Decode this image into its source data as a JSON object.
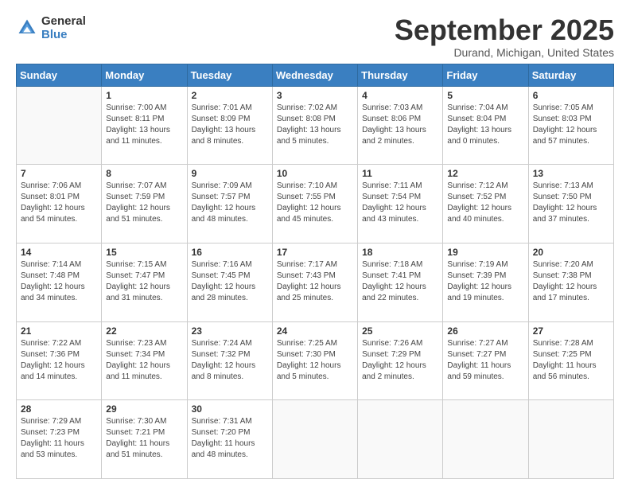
{
  "header": {
    "logo_line1": "General",
    "logo_line2": "Blue",
    "month": "September 2025",
    "location": "Durand, Michigan, United States"
  },
  "weekdays": [
    "Sunday",
    "Monday",
    "Tuesday",
    "Wednesday",
    "Thursday",
    "Friday",
    "Saturday"
  ],
  "weeks": [
    [
      {
        "day": "",
        "info": ""
      },
      {
        "day": "1",
        "info": "Sunrise: 7:00 AM\nSunset: 8:11 PM\nDaylight: 13 hours\nand 11 minutes."
      },
      {
        "day": "2",
        "info": "Sunrise: 7:01 AM\nSunset: 8:09 PM\nDaylight: 13 hours\nand 8 minutes."
      },
      {
        "day": "3",
        "info": "Sunrise: 7:02 AM\nSunset: 8:08 PM\nDaylight: 13 hours\nand 5 minutes."
      },
      {
        "day": "4",
        "info": "Sunrise: 7:03 AM\nSunset: 8:06 PM\nDaylight: 13 hours\nand 2 minutes."
      },
      {
        "day": "5",
        "info": "Sunrise: 7:04 AM\nSunset: 8:04 PM\nDaylight: 13 hours\nand 0 minutes."
      },
      {
        "day": "6",
        "info": "Sunrise: 7:05 AM\nSunset: 8:03 PM\nDaylight: 12 hours\nand 57 minutes."
      }
    ],
    [
      {
        "day": "7",
        "info": "Sunrise: 7:06 AM\nSunset: 8:01 PM\nDaylight: 12 hours\nand 54 minutes."
      },
      {
        "day": "8",
        "info": "Sunrise: 7:07 AM\nSunset: 7:59 PM\nDaylight: 12 hours\nand 51 minutes."
      },
      {
        "day": "9",
        "info": "Sunrise: 7:09 AM\nSunset: 7:57 PM\nDaylight: 12 hours\nand 48 minutes."
      },
      {
        "day": "10",
        "info": "Sunrise: 7:10 AM\nSunset: 7:55 PM\nDaylight: 12 hours\nand 45 minutes."
      },
      {
        "day": "11",
        "info": "Sunrise: 7:11 AM\nSunset: 7:54 PM\nDaylight: 12 hours\nand 43 minutes."
      },
      {
        "day": "12",
        "info": "Sunrise: 7:12 AM\nSunset: 7:52 PM\nDaylight: 12 hours\nand 40 minutes."
      },
      {
        "day": "13",
        "info": "Sunrise: 7:13 AM\nSunset: 7:50 PM\nDaylight: 12 hours\nand 37 minutes."
      }
    ],
    [
      {
        "day": "14",
        "info": "Sunrise: 7:14 AM\nSunset: 7:48 PM\nDaylight: 12 hours\nand 34 minutes."
      },
      {
        "day": "15",
        "info": "Sunrise: 7:15 AM\nSunset: 7:47 PM\nDaylight: 12 hours\nand 31 minutes."
      },
      {
        "day": "16",
        "info": "Sunrise: 7:16 AM\nSunset: 7:45 PM\nDaylight: 12 hours\nand 28 minutes."
      },
      {
        "day": "17",
        "info": "Sunrise: 7:17 AM\nSunset: 7:43 PM\nDaylight: 12 hours\nand 25 minutes."
      },
      {
        "day": "18",
        "info": "Sunrise: 7:18 AM\nSunset: 7:41 PM\nDaylight: 12 hours\nand 22 minutes."
      },
      {
        "day": "19",
        "info": "Sunrise: 7:19 AM\nSunset: 7:39 PM\nDaylight: 12 hours\nand 19 minutes."
      },
      {
        "day": "20",
        "info": "Sunrise: 7:20 AM\nSunset: 7:38 PM\nDaylight: 12 hours\nand 17 minutes."
      }
    ],
    [
      {
        "day": "21",
        "info": "Sunrise: 7:22 AM\nSunset: 7:36 PM\nDaylight: 12 hours\nand 14 minutes."
      },
      {
        "day": "22",
        "info": "Sunrise: 7:23 AM\nSunset: 7:34 PM\nDaylight: 12 hours\nand 11 minutes."
      },
      {
        "day": "23",
        "info": "Sunrise: 7:24 AM\nSunset: 7:32 PM\nDaylight: 12 hours\nand 8 minutes."
      },
      {
        "day": "24",
        "info": "Sunrise: 7:25 AM\nSunset: 7:30 PM\nDaylight: 12 hours\nand 5 minutes."
      },
      {
        "day": "25",
        "info": "Sunrise: 7:26 AM\nSunset: 7:29 PM\nDaylight: 12 hours\nand 2 minutes."
      },
      {
        "day": "26",
        "info": "Sunrise: 7:27 AM\nSunset: 7:27 PM\nDaylight: 11 hours\nand 59 minutes."
      },
      {
        "day": "27",
        "info": "Sunrise: 7:28 AM\nSunset: 7:25 PM\nDaylight: 11 hours\nand 56 minutes."
      }
    ],
    [
      {
        "day": "28",
        "info": "Sunrise: 7:29 AM\nSunset: 7:23 PM\nDaylight: 11 hours\nand 53 minutes."
      },
      {
        "day": "29",
        "info": "Sunrise: 7:30 AM\nSunset: 7:21 PM\nDaylight: 11 hours\nand 51 minutes."
      },
      {
        "day": "30",
        "info": "Sunrise: 7:31 AM\nSunset: 7:20 PM\nDaylight: 11 hours\nand 48 minutes."
      },
      {
        "day": "",
        "info": ""
      },
      {
        "day": "",
        "info": ""
      },
      {
        "day": "",
        "info": ""
      },
      {
        "day": "",
        "info": ""
      }
    ]
  ]
}
